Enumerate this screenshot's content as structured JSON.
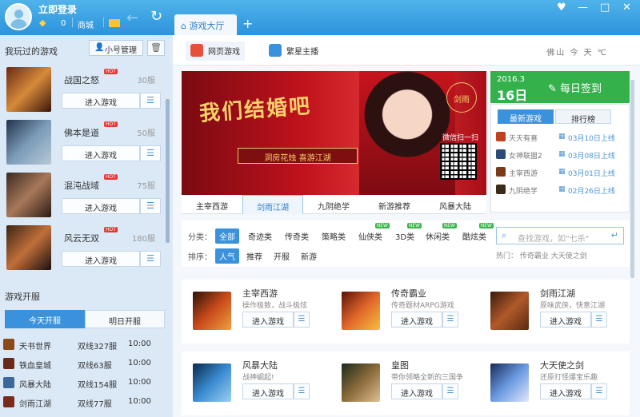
{
  "topbar": {
    "login": "立即登录",
    "gem_count": "0",
    "mall": "商城",
    "tab_label": "游戏大厅",
    "tab_plus": "+",
    "controls": [
      "♥",
      "—",
      "□",
      "✕"
    ]
  },
  "left": {
    "played_header": "我玩过的游戏",
    "alt_manage": "小号管理",
    "games": [
      {
        "name": "战国之怒",
        "server": "30服",
        "enter": "进入游戏",
        "hot": "HOT"
      },
      {
        "name": "佛本是道",
        "server": "50服",
        "enter": "进入游戏",
        "hot": "HOT"
      },
      {
        "name": "混沌战域",
        "server": "75服",
        "enter": "进入游戏",
        "hot": "HOT"
      },
      {
        "name": "风云无双",
        "server": "180服",
        "enter": "进入游戏",
        "hot": "HOT"
      }
    ],
    "open_header": "游戏开服",
    "open_tabs": [
      "今天开服",
      "明日开服"
    ],
    "open_rows": [
      {
        "name": "天书世界",
        "server": "双线327服",
        "time": "10:00"
      },
      {
        "name": "铁血皇城",
        "server": "双线63服",
        "time": "10:00"
      },
      {
        "name": "风暴大陆",
        "server": "双线154服",
        "time": "10:00"
      },
      {
        "name": "剑雨江湖",
        "server": "双线77服",
        "time": "10:00"
      }
    ]
  },
  "main": {
    "subtabs": [
      "网页游戏",
      "繁星主播"
    ],
    "weather": "佛山 今 天 ℃",
    "banner": {
      "title": "我们结婚吧",
      "subtitle": "洞房花烛 喜游江湖",
      "logo": "剑雨",
      "qr_text": "微信扫一扫"
    },
    "banner_tabs": [
      "主宰西游",
      "剑雨江湖",
      "九阴绝学",
      "新游推荐",
      "风暴大陆"
    ],
    "signin": {
      "date_top": "2016.3",
      "date_day": "16日",
      "label": "每日签到"
    },
    "side_tabs": [
      "最新游戏",
      "排行榜"
    ],
    "side_rows": [
      {
        "name": "天天有喜",
        "date": "03月10日上线"
      },
      {
        "name": "女神联盟2",
        "date": "03月08日上线"
      },
      {
        "name": "主宰西游",
        "date": "03月01日上线"
      },
      {
        "name": "九阴绝学",
        "date": "02月26日上线"
      }
    ],
    "filters": {
      "cat_label": "分类：",
      "cats": [
        "全部",
        "奇迹类",
        "传奇类",
        "策略类",
        "仙侠类",
        "3D类",
        "休闲类",
        "酷炫类"
      ],
      "sort_label": "排序：",
      "sorts": [
        "人气",
        "推荐",
        "开服",
        "新游"
      ],
      "search_placeholder": "查找游戏，如\"七杀\"",
      "hot_label": "热门：",
      "hot_games": [
        "传奇霸业",
        "大天使之剑"
      ],
      "new_tag": "NEW"
    },
    "cards": [
      [
        {
          "name": "主宰西游",
          "desc": "操作极致，战斗极炫",
          "enter": "进入游戏"
        },
        {
          "name": "传奇霸业",
          "desc": "传奇题材ARPG游戏",
          "enter": "进入游戏"
        },
        {
          "name": "剑雨江湖",
          "desc": "原味武侠，快意江湖",
          "enter": "进入游戏"
        }
      ],
      [
        {
          "name": "风暴大陆",
          "desc": "战神崛起!",
          "enter": "进入游戏"
        },
        {
          "name": "皇图",
          "desc": "带你领略全新的三国争",
          "enter": "进入游戏"
        },
        {
          "name": "大天使之剑",
          "desc": "还原打怪爆宝乐趣",
          "enter": "进入游戏"
        }
      ]
    ]
  },
  "colors": {
    "accent": "#2d93dc",
    "green": "#35b14b",
    "hot": "#e33333"
  }
}
